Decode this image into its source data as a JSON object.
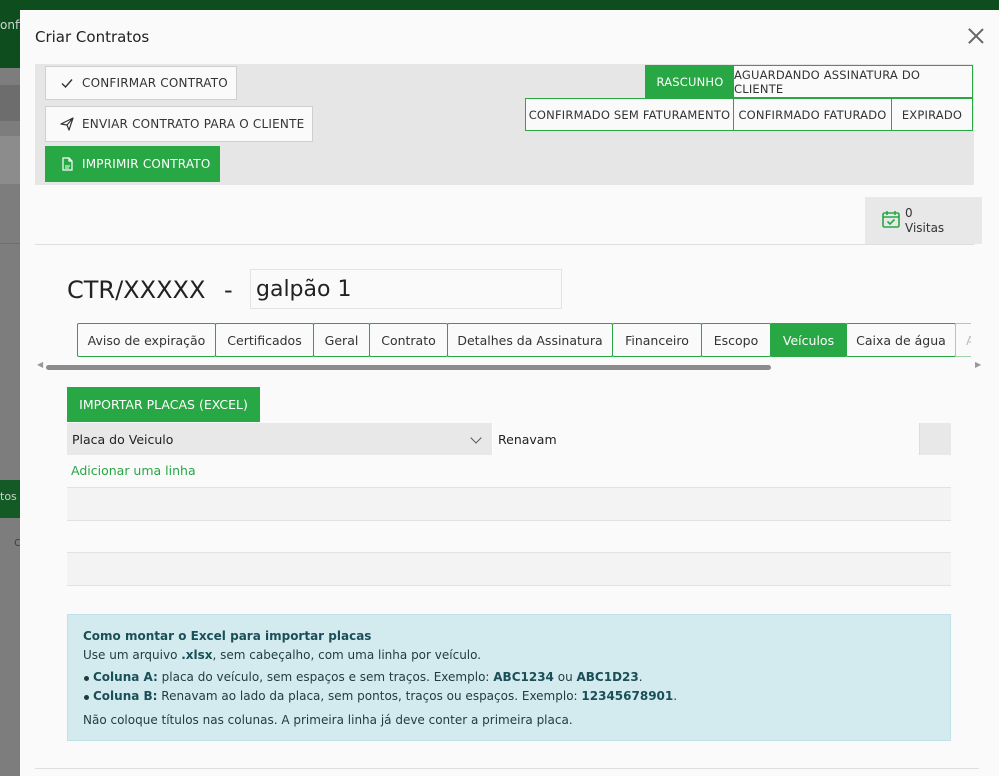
{
  "background": {
    "topbar_text": "onfi",
    "side_text_1": "tos",
    "side_text_2": "c"
  },
  "modal": {
    "title": "Criar Contratos"
  },
  "actions": {
    "confirm": "CONFIRMAR CONTRATO",
    "send": "ENVIAR CONTRATO PARA O CLIENTE",
    "print": "IMPRIMIR CONTRATO"
  },
  "statuses": [
    {
      "label": "RASCUNHO",
      "active": true
    },
    {
      "label": "AGUARDANDO ASSINATURA DO CLIENTE",
      "active": false
    },
    {
      "label": "CONFIRMADO SEM FATURAMENTO",
      "active": false
    },
    {
      "label": "CONFIRMADO FATURADO",
      "active": false
    },
    {
      "label": "EXPIRADO",
      "active": false
    }
  ],
  "visits": {
    "count": "0",
    "label": "Visitas"
  },
  "contract": {
    "code": "CTR/XXXXX",
    "separator": "-",
    "name": "galpão 1"
  },
  "tabs": [
    {
      "label": "Aviso de expiração"
    },
    {
      "label": "Certificados"
    },
    {
      "label": "Geral"
    },
    {
      "label": "Contrato"
    },
    {
      "label": "Detalhes da Assinatura"
    },
    {
      "label": "Financeiro"
    },
    {
      "label": "Escopo"
    },
    {
      "label": "Veículos",
      "active": true
    },
    {
      "label": "Caixa de água"
    },
    {
      "label": "An"
    }
  ],
  "vehicles": {
    "import_label": "IMPORTAR PLACAS (EXCEL)",
    "col_plate": "Placa do Veiculo",
    "col_renavam": "Renavam",
    "add_line": "Adicionar uma linha"
  },
  "info": {
    "title": "Como montar o Excel para importar placas",
    "line1_a": "Use um arquivo ",
    "line1_b": ".xlsx",
    "line1_c": ", sem cabeçalho, com uma linha por veículo.",
    "a_label": "Coluna A:",
    "a_text": " placa do veículo, sem espaços e sem traços. Exemplo: ",
    "a_ex1": "ABC1234",
    "a_or": " ou ",
    "a_ex2": "ABC1D23",
    "a_end": ".",
    "b_label": "Coluna B:",
    "b_text": " Renavam ao lado da placa, sem pontos, traços ou espaços. Exemplo: ",
    "b_ex": "12345678901",
    "b_end": ".",
    "footer": "Não coloque títulos nas colunas. A primeira linha já deve conter a primeira placa."
  },
  "colors": {
    "accent": "#28a745",
    "info_bg": "#d3ebef"
  }
}
